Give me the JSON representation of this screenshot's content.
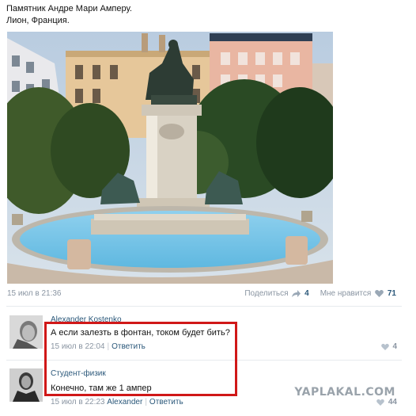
{
  "post": {
    "line1": "Памятник Андре Мари Амперу.",
    "line2": "Лион, Франция.",
    "timestamp": "15 июл в 21:36",
    "share_label": "Поделиться",
    "share_count": "4",
    "like_label": "Мне нравится",
    "like_count": "71"
  },
  "comments": [
    {
      "author": "Alexander Kostenko",
      "text": "А если залезть в фонтан, током будет бить?",
      "time": "15 июл в 22:04",
      "reply_label": "Ответить",
      "likes": "4"
    },
    {
      "author": "Студент-физик",
      "text": "Конечно, там же 1 ампер",
      "time": "15 июл в 22:23",
      "reply_to": "Alexander",
      "reply_label": "Ответить",
      "likes": "44"
    }
  ],
  "watermark": "YAPLAKAL.COM",
  "colors": {
    "link": "#2b587a",
    "meta": "#8a95a2",
    "highlight": "#d01818"
  }
}
